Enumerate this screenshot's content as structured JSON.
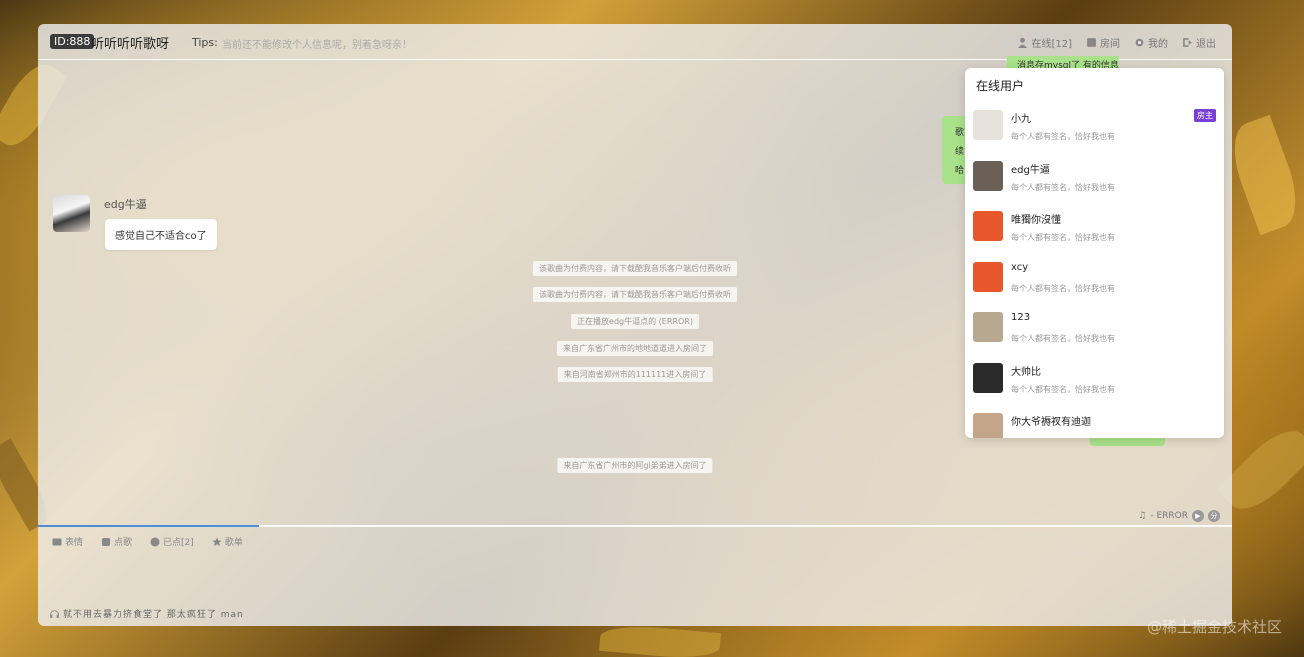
{
  "header": {
    "room_id": "ID:888",
    "room_name": "听听听听歌呀",
    "tips_label": "Tips:",
    "tips_text": "当前还不能修改个人信息呢，别着急呀亲！",
    "nav": [
      {
        "icon": "user-icon",
        "label": "在线[12]"
      },
      {
        "icon": "room-icon",
        "label": "房间"
      },
      {
        "icon": "gear-icon",
        "label": "我的"
      },
      {
        "icon": "logout-icon",
        "label": "退出"
      }
    ]
  },
  "messages": {
    "top_right_text": "消息存mysql了 有的信息放redis",
    "right_lines": [
      "歌",
      "续",
      "哈"
    ],
    "left_message": {
      "name": "edg牛逼",
      "text": "感觉自己不适合co了"
    }
  },
  "system_messages": [
    "该歌曲为付费内容，请下载酷我音乐客户端后付费收听",
    "该歌曲为付费内容，请下载酷我音乐客户端后付费收听",
    "正在播放edg牛逼点的 (ERROR)",
    "来自广东省广州市的地地道道进入房间了",
    "来自河南省郑州市的111111进入房间了",
    "来自广东省广州市的阿gi弟弟进入房间了"
  ],
  "player": {
    "status": "- ERROR",
    "play_icon": "play-icon",
    "share_icon": "share-icon",
    "share_glyph": "分"
  },
  "progress": {
    "fraction": 0.185,
    "color": "#4d8ed8"
  },
  "toolbar": [
    {
      "icon": "emoji-icon",
      "label": "表情"
    },
    {
      "icon": "song-request-icon",
      "label": "点歌"
    },
    {
      "icon": "check-circle-icon",
      "label": "已点[2]"
    },
    {
      "icon": "star-icon",
      "label": "歌单"
    }
  ],
  "now_playing": "就不用去暴力挤食堂了 那太疯狂了 man",
  "online_users": {
    "title": "在线用户",
    "users": [
      {
        "name": "小九",
        "signature": "每个人都有签名，恰好我也有",
        "badge": "房主",
        "avatar_color": "#e8e2dc"
      },
      {
        "name": "edg牛逼",
        "signature": "每个人都有签名，恰好我也有",
        "badge": "",
        "avatar_color": "#6b6058"
      },
      {
        "name": "唯獨你沒懂",
        "signature": "每个人都有签名，恰好我也有",
        "badge": "",
        "avatar_color": "#e8572b"
      },
      {
        "name": "xcy",
        "signature": "每个人都有签名，恰好我也有",
        "badge": "",
        "avatar_color": "#e8572b"
      },
      {
        "name": "123",
        "signature": "每个人都有签名，恰好我也有",
        "badge": "",
        "avatar_color": "#b8a890"
      },
      {
        "name": "大帅比",
        "signature": "每个人都有签名，恰好我也有",
        "badge": "",
        "avatar_color": "#2a2a2a"
      },
      {
        "name": "你大爷褥衩有迪迦",
        "signature": "",
        "badge": "",
        "avatar_color": "#c4a58a"
      }
    ]
  },
  "watermark": "@稀土掘金技术社区"
}
